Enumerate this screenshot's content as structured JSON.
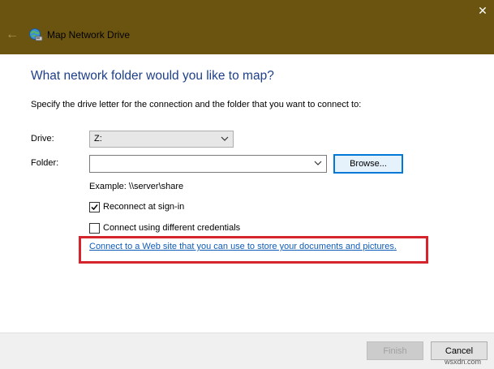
{
  "window": {
    "title": "Map Network Drive",
    "back_glyph": "←",
    "close_glyph": "✕"
  },
  "dialog": {
    "heading": "What network folder would you like to map?",
    "instruction": "Specify the drive letter for the connection and the folder that you want to connect to:",
    "drive_label": "Drive:",
    "drive_value": "Z:",
    "folder_label": "Folder:",
    "folder_value": "",
    "browse_label": "Browse...",
    "example": "Example: \\\\server\\share",
    "reconnect_label": "Reconnect at sign-in",
    "reconnect_checked": true,
    "credentials_label": "Connect using different credentials",
    "credentials_checked": false,
    "web_link": "Connect to a Web site that you can use to store your documents and pictures",
    "web_link_suffix": "."
  },
  "footer": {
    "finish_label": "Finish",
    "cancel_label": "Cancel"
  },
  "watermark": "wsxdn.com",
  "icons": {
    "back": "back-arrow-icon",
    "app": "network-drive-icon",
    "close": "close-icon",
    "chevron": "chevron-down-icon",
    "check": "checkmark-icon"
  },
  "colors": {
    "titlebar": "#6b5410",
    "heading": "#1e3f8a",
    "link": "#0f5cb8",
    "highlight_box": "#d5242b",
    "focus_border": "#0078d7"
  }
}
